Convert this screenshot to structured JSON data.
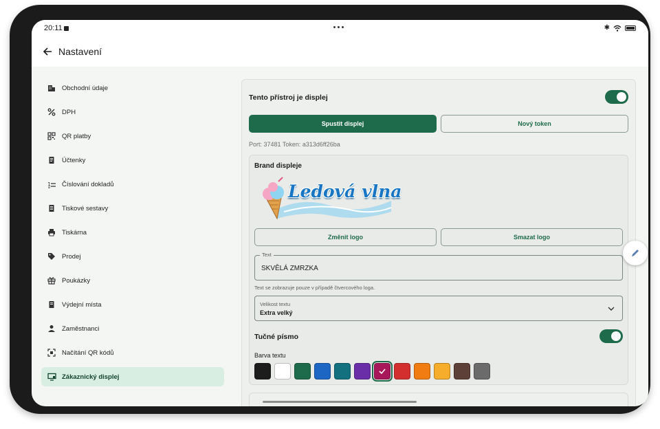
{
  "status": {
    "time": "20:11"
  },
  "appbar": {
    "title": "Nastavení"
  },
  "sidebar": {
    "items": [
      {
        "label": "Obchodní údaje",
        "icon": "building-icon"
      },
      {
        "label": "DPH",
        "icon": "percent-icon"
      },
      {
        "label": "QR platby",
        "icon": "qr-code-icon"
      },
      {
        "label": "Účtenky",
        "icon": "receipt-icon"
      },
      {
        "label": "Číslování dokladů",
        "icon": "numbering-icon"
      },
      {
        "label": "Tiskové sestavy",
        "icon": "report-icon"
      },
      {
        "label": "Tiskárna",
        "icon": "printer-icon"
      },
      {
        "label": "Prodej",
        "icon": "tag-icon"
      },
      {
        "label": "Poukázky",
        "icon": "gift-icon"
      },
      {
        "label": "Výdejní místa",
        "icon": "pickup-icon"
      },
      {
        "label": "Zaměstnanci",
        "icon": "person-icon"
      },
      {
        "label": "Načítání QR kódů",
        "icon": "qr-scan-icon"
      },
      {
        "label": "Zákaznický displej",
        "icon": "display-icon",
        "active": true
      }
    ]
  },
  "display": {
    "is_display_label": "Tento přístroj je displej",
    "is_display_on": true,
    "start_button": "Spustit displej",
    "new_token_button": "Nový token",
    "port_token": "Port: 37481   Token: a313d6ff26ba"
  },
  "brand": {
    "title": "Brand displeje",
    "logo_text": "Ledová vlna",
    "change_logo": "Změnit logo",
    "delete_logo": "Smazat logo",
    "text_label": "Text",
    "text_value": "SKVĚLÁ ZMRZKA",
    "text_helper": "Text se zobrazuje pouze v případě čtvercového loga.",
    "size_label": "Velikost textu",
    "size_value": "Extra velký",
    "bold_label": "Tučné písmo",
    "bold_on": true,
    "color_label": "Barva textu",
    "colors": [
      "#1c1c1c",
      "#ffffff",
      "#1e6b4b",
      "#1d66c4",
      "#13707e",
      "#6a2fa8",
      "#a8175a",
      "#d32f2f",
      "#f07c12",
      "#f5ad2b",
      "#5d4037",
      "#6b6b6b"
    ],
    "selected_color_index": 6
  }
}
